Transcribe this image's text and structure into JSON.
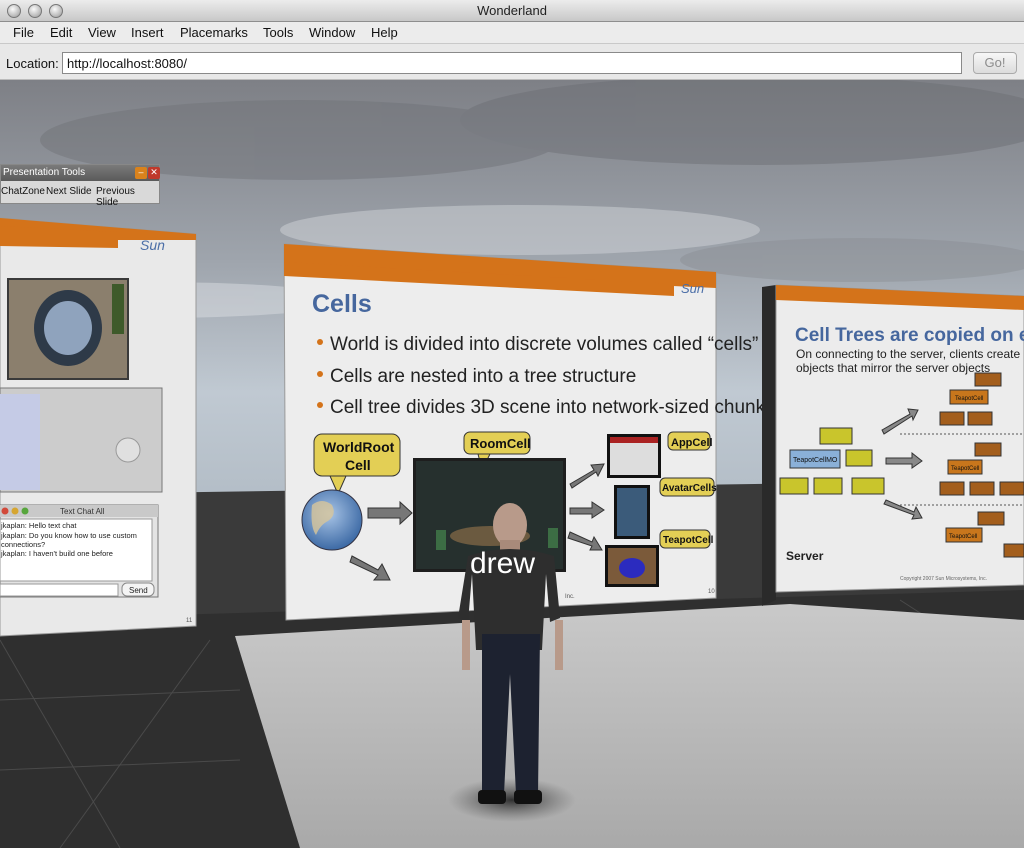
{
  "window": {
    "title": "Wonderland"
  },
  "menu": {
    "items": [
      "File",
      "Edit",
      "View",
      "Insert",
      "Placemarks",
      "Tools",
      "Window",
      "Help"
    ]
  },
  "location": {
    "label": "Location:",
    "value": "http://localhost:8080/",
    "go_label": "Go!"
  },
  "presentation_tools": {
    "title": "Presentation Tools",
    "buttons": [
      "ChatZone",
      "Next Slide",
      "Previous Slide"
    ]
  },
  "avatar": {
    "name": "drew"
  },
  "slides": {
    "center": {
      "title": "Cells",
      "bullets": [
        "World is divided into discrete volumes called “cells”",
        "Cells are nested into a tree structure",
        "Cell tree divides 3D scene into network-sized chunks"
      ],
      "callouts": {
        "world_root_1": "WorldRoot",
        "world_root_2": "Cell",
        "room": "RoomCell",
        "app": "AppCell",
        "avatar": "AvatarCells",
        "teapot": "TeapotCell"
      },
      "logo": "Sun",
      "page": "10",
      "footer": "Inc."
    },
    "right": {
      "title": "Cell Trees are copied on each c",
      "line1": "On connecting to the server, clients create a local hierarch",
      "line2": "objects that mirror the server objects",
      "root_label": "TeapotCellMO",
      "node_labels": [
        "TeapotCell",
        "TeapotCell",
        "TeapotCell"
      ],
      "server_label": "Server",
      "footer": "Copyright 2007 Sun Microsystems, Inc."
    },
    "left": {
      "logo": "Sun",
      "page": "11",
      "chat_title": "Text Chat All",
      "chat_lines": [
        "jkaplan: Hello text chat",
        "jkaplan: Do you know how to use custom",
        "connections?",
        "jkaplan: I haven't build one before"
      ],
      "send_label": "Send"
    }
  },
  "colors": {
    "slide_orange": "#d4731a",
    "callout_yellow": "#e3cf55",
    "tree_yellow": "#c9c52c",
    "tree_orange": "#c8761c",
    "floor_light": "#bdbdbd",
    "floor_dark": "#3b3b3b"
  }
}
